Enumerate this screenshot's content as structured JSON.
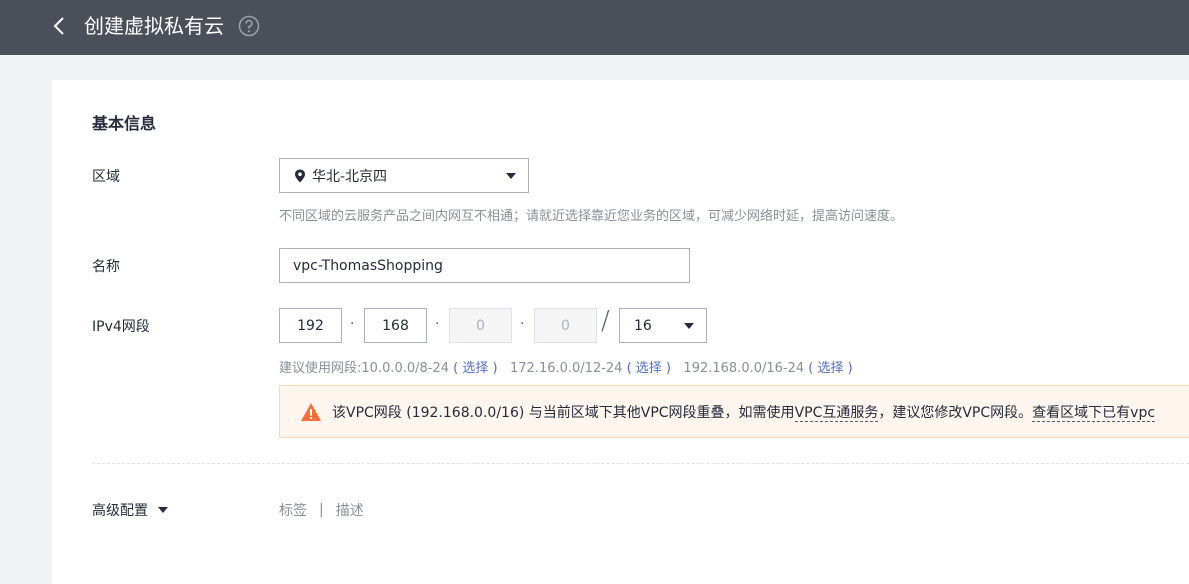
{
  "header": {
    "title": "创建虚拟私有云",
    "back_icon": "chevron-left-icon",
    "help_icon": "question-circle-icon"
  },
  "basic": {
    "section_title": "基本信息",
    "region": {
      "label": "区域",
      "value": "华北-北京四",
      "icon": "location-pin-icon",
      "hint": "不同区域的云服务产品之间内网互不相通；请就近选择靠近您业务的区域，可减少网络时延，提高访问速度。"
    },
    "name": {
      "label": "名称",
      "value": "vpc-ThomasShopping"
    },
    "ipv4": {
      "label": "IPv4网段",
      "octets": [
        "192",
        "168",
        "0",
        "0"
      ],
      "separator": "·",
      "slash": "/",
      "mask": "16",
      "suggest_prefix": "建议使用网段:",
      "suggestions": [
        {
          "range": "10.0.0.0/8-24",
          "action": "( 选择 )"
        },
        {
          "range": "172.16.0.0/12-24",
          "action": "( 选择 )"
        },
        {
          "range": "192.168.0.0/16-24",
          "action": "( 选择 )"
        }
      ]
    },
    "warning": {
      "icon": "warning-triangle-icon",
      "text_before": "该VPC网段 (192.168.0.0/16) 与当前区域下其他VPC网段重叠，如需使用",
      "link1": "VPC互通服务",
      "text_middle": "，建议您修改VPC网段。",
      "link2": "查看区域下已有vpc",
      "color": "#f66f3b"
    }
  },
  "advanced": {
    "label": "高级配置",
    "items": [
      "标签",
      "描述"
    ],
    "separator": "|"
  },
  "colors": {
    "topbar": "#4b4f5a",
    "link": "#526ecc",
    "warning_bg": "#fef6ee"
  }
}
